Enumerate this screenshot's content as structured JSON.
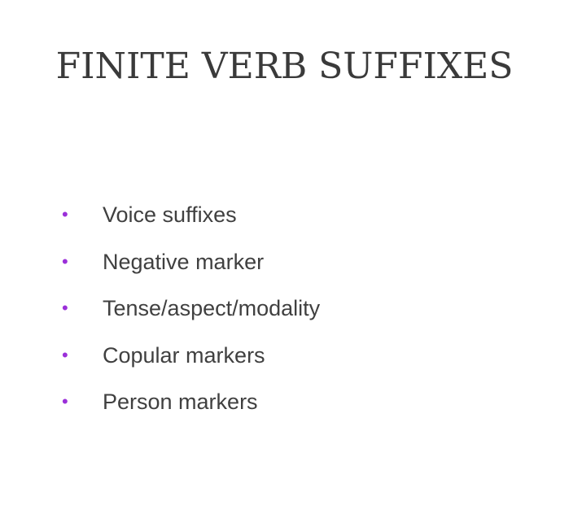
{
  "slide": {
    "title": "FINITE VERB SUFFIXES",
    "bullet_symbol": "•",
    "bullets": [
      {
        "text": "Voice suffixes"
      },
      {
        "text": "Negative marker"
      },
      {
        "text": "Tense/aspect/modality"
      },
      {
        "text": "Copular markers"
      },
      {
        "text": "Person markers"
      }
    ]
  },
  "colors": {
    "title": "#3a3a3a",
    "text": "#404040",
    "bullet": "#9b30d9",
    "background": "#ffffff"
  }
}
